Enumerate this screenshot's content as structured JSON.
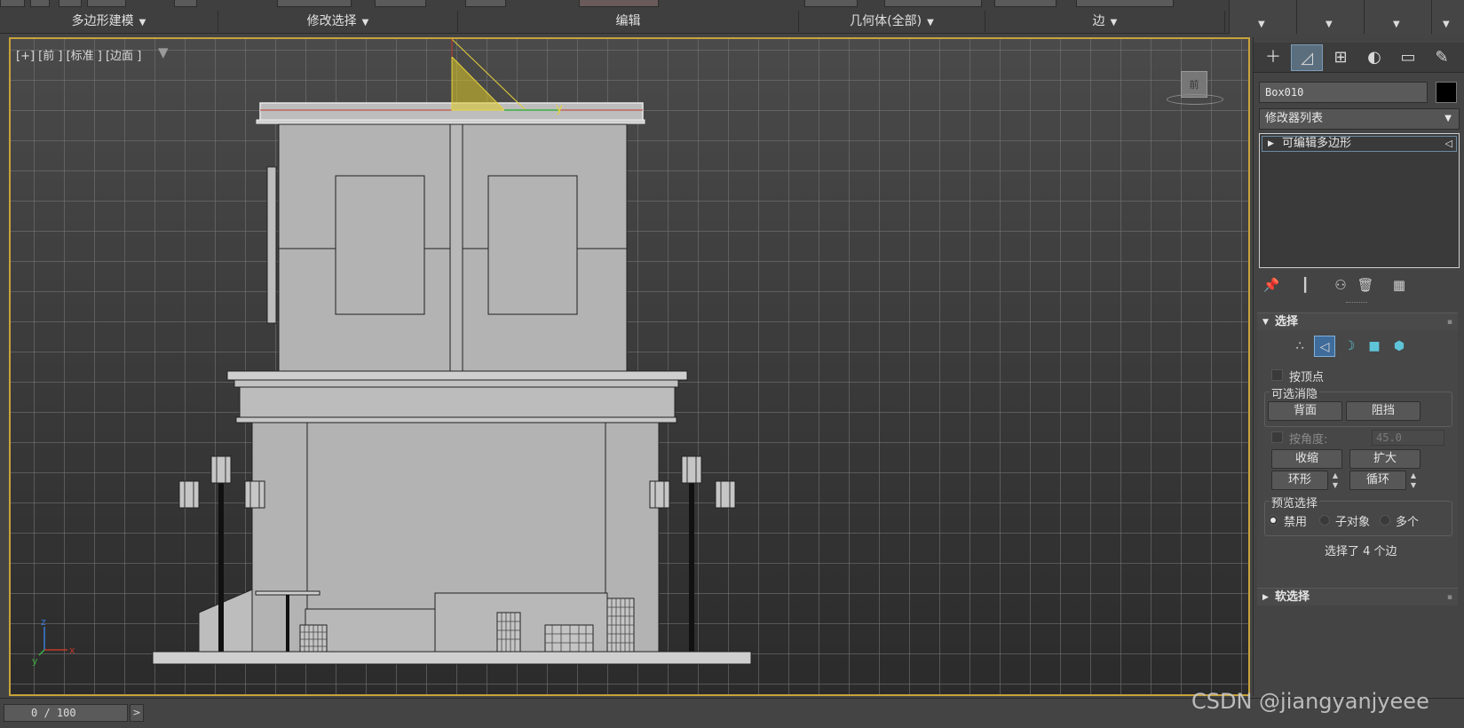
{
  "ribbon": {
    "tabs": [
      {
        "label": "多边形建模"
      },
      {
        "label": "修改选择"
      },
      {
        "label": "编辑"
      },
      {
        "label": "几何体(全部)"
      },
      {
        "label": "边"
      }
    ]
  },
  "viewport": {
    "label": "[+] [前 ] [标准 ] [边面 ]",
    "axis_label": "y",
    "viewcube_label": "前",
    "tripod_z": "z",
    "tripod_x": "x",
    "tripod_y": "y"
  },
  "command_panel": {
    "object_name": "Box010",
    "object_color": "#000000",
    "modifier_list_label": "修改器列表",
    "stack_items": [
      {
        "label": "可编辑多边形"
      }
    ],
    "selection_rollout": {
      "title": "选择",
      "by_vertex_label": "按顶点",
      "ignore_backfacing_group": "可选消隐",
      "backface_button": "背面",
      "occluded_button": "阻挡",
      "by_angle_label": "按角度:",
      "by_angle_value": "45.0",
      "shrink_button": "收缩",
      "grow_button": "扩大",
      "ring_button": "环形",
      "loop_button": "循环",
      "preview_group": "预览选择",
      "preview_off": "禁用",
      "preview_subobject": "子对象",
      "preview_multi": "多个",
      "status": "选择了 4 个边"
    },
    "soft_selection_rollout": {
      "title": "软选择"
    }
  },
  "timeline": {
    "frame_display": "0 / 100"
  },
  "watermark": "CSDN @jiangyanjyeee"
}
